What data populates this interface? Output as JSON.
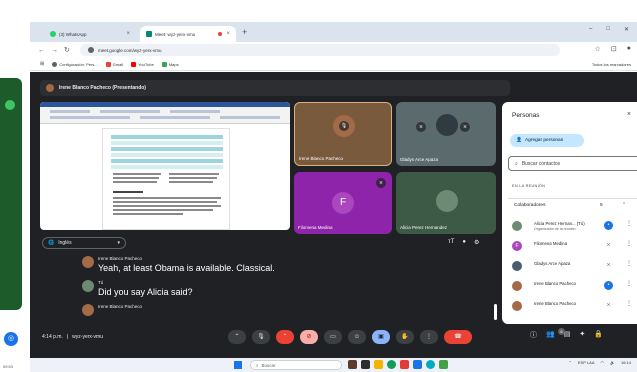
{
  "left_panel": {
    "time": "09:53"
  },
  "tabs": [
    {
      "label": "(3) WhatsApp",
      "close": "×"
    },
    {
      "label": "Meet: wyz-yerx-vmu",
      "close": "×"
    }
  ],
  "new_tab": "+",
  "window_controls": {
    "minimize": "–",
    "maximize": "□",
    "close": "✕"
  },
  "address": {
    "url": "meet.google.com/wyz-yerx-vmu"
  },
  "bookmarks": [
    {
      "label": "Configuración: Pers...",
      "color": "#5f6368"
    },
    {
      "label": "Gmail",
      "color": "#ea4335"
    },
    {
      "label": "YouTube",
      "color": "#ff0000"
    },
    {
      "label": "Maps",
      "color": "#34a853"
    }
  ],
  "all_bookmarks": "Todos los marcadores",
  "meet": {
    "presenter_banner": "Irene Blanco Pacheco (Presentando)",
    "tiles": [
      {
        "name": "Irene Blanco Pacheco"
      },
      {
        "name": "Gladys Arce Apaza"
      },
      {
        "name": "Filomena Medina",
        "letter": "F"
      },
      {
        "name": "Alicia Perez Hernandez"
      }
    ],
    "caption_language": "Inglés",
    "caption_controls": {
      "font": "тT"
    },
    "captions": [
      {
        "speaker": "Irene Blanco Pacheco",
        "text": "Yeah, at least Obama is available. Classical."
      },
      {
        "speaker": "Tú",
        "text": "Did you say Alicia said?"
      },
      {
        "speaker": "Irene Blanco Pacheco",
        "text": ""
      }
    ],
    "time": "4:14 p.m.",
    "meeting_code": "wyz-yerx-vmu",
    "participants_badge": "6"
  },
  "people_panel": {
    "title": "Personas",
    "close": "×",
    "add_people": "Agregar personas",
    "search_placeholder": "Buscar contactos",
    "section_label": "EN LA REUNIÓN",
    "collaborators_label": "Colaboradores",
    "collaborators_count": "5",
    "participants": [
      {
        "name": "Alicia Perez Hernan... (Tú)",
        "subtitle": "Organizador de la reunión",
        "color": "#6d8b74"
      },
      {
        "name": "Filomena Medina",
        "subtitle": "",
        "color": "#ab47bc",
        "letter": "F"
      },
      {
        "name": "Gladys Arce Apaza",
        "subtitle": "",
        "color": "#4a5d70"
      },
      {
        "name": "Irene Blanco Pacheco",
        "subtitle": "",
        "color": "#a26a46"
      },
      {
        "name": "Irene Blanco Pacheco",
        "subtitle": "",
        "color": "#a26a46"
      }
    ]
  },
  "taskbar": {
    "search_placeholder": "Buscar",
    "language": "ESP LAA",
    "clock": "16:14"
  }
}
